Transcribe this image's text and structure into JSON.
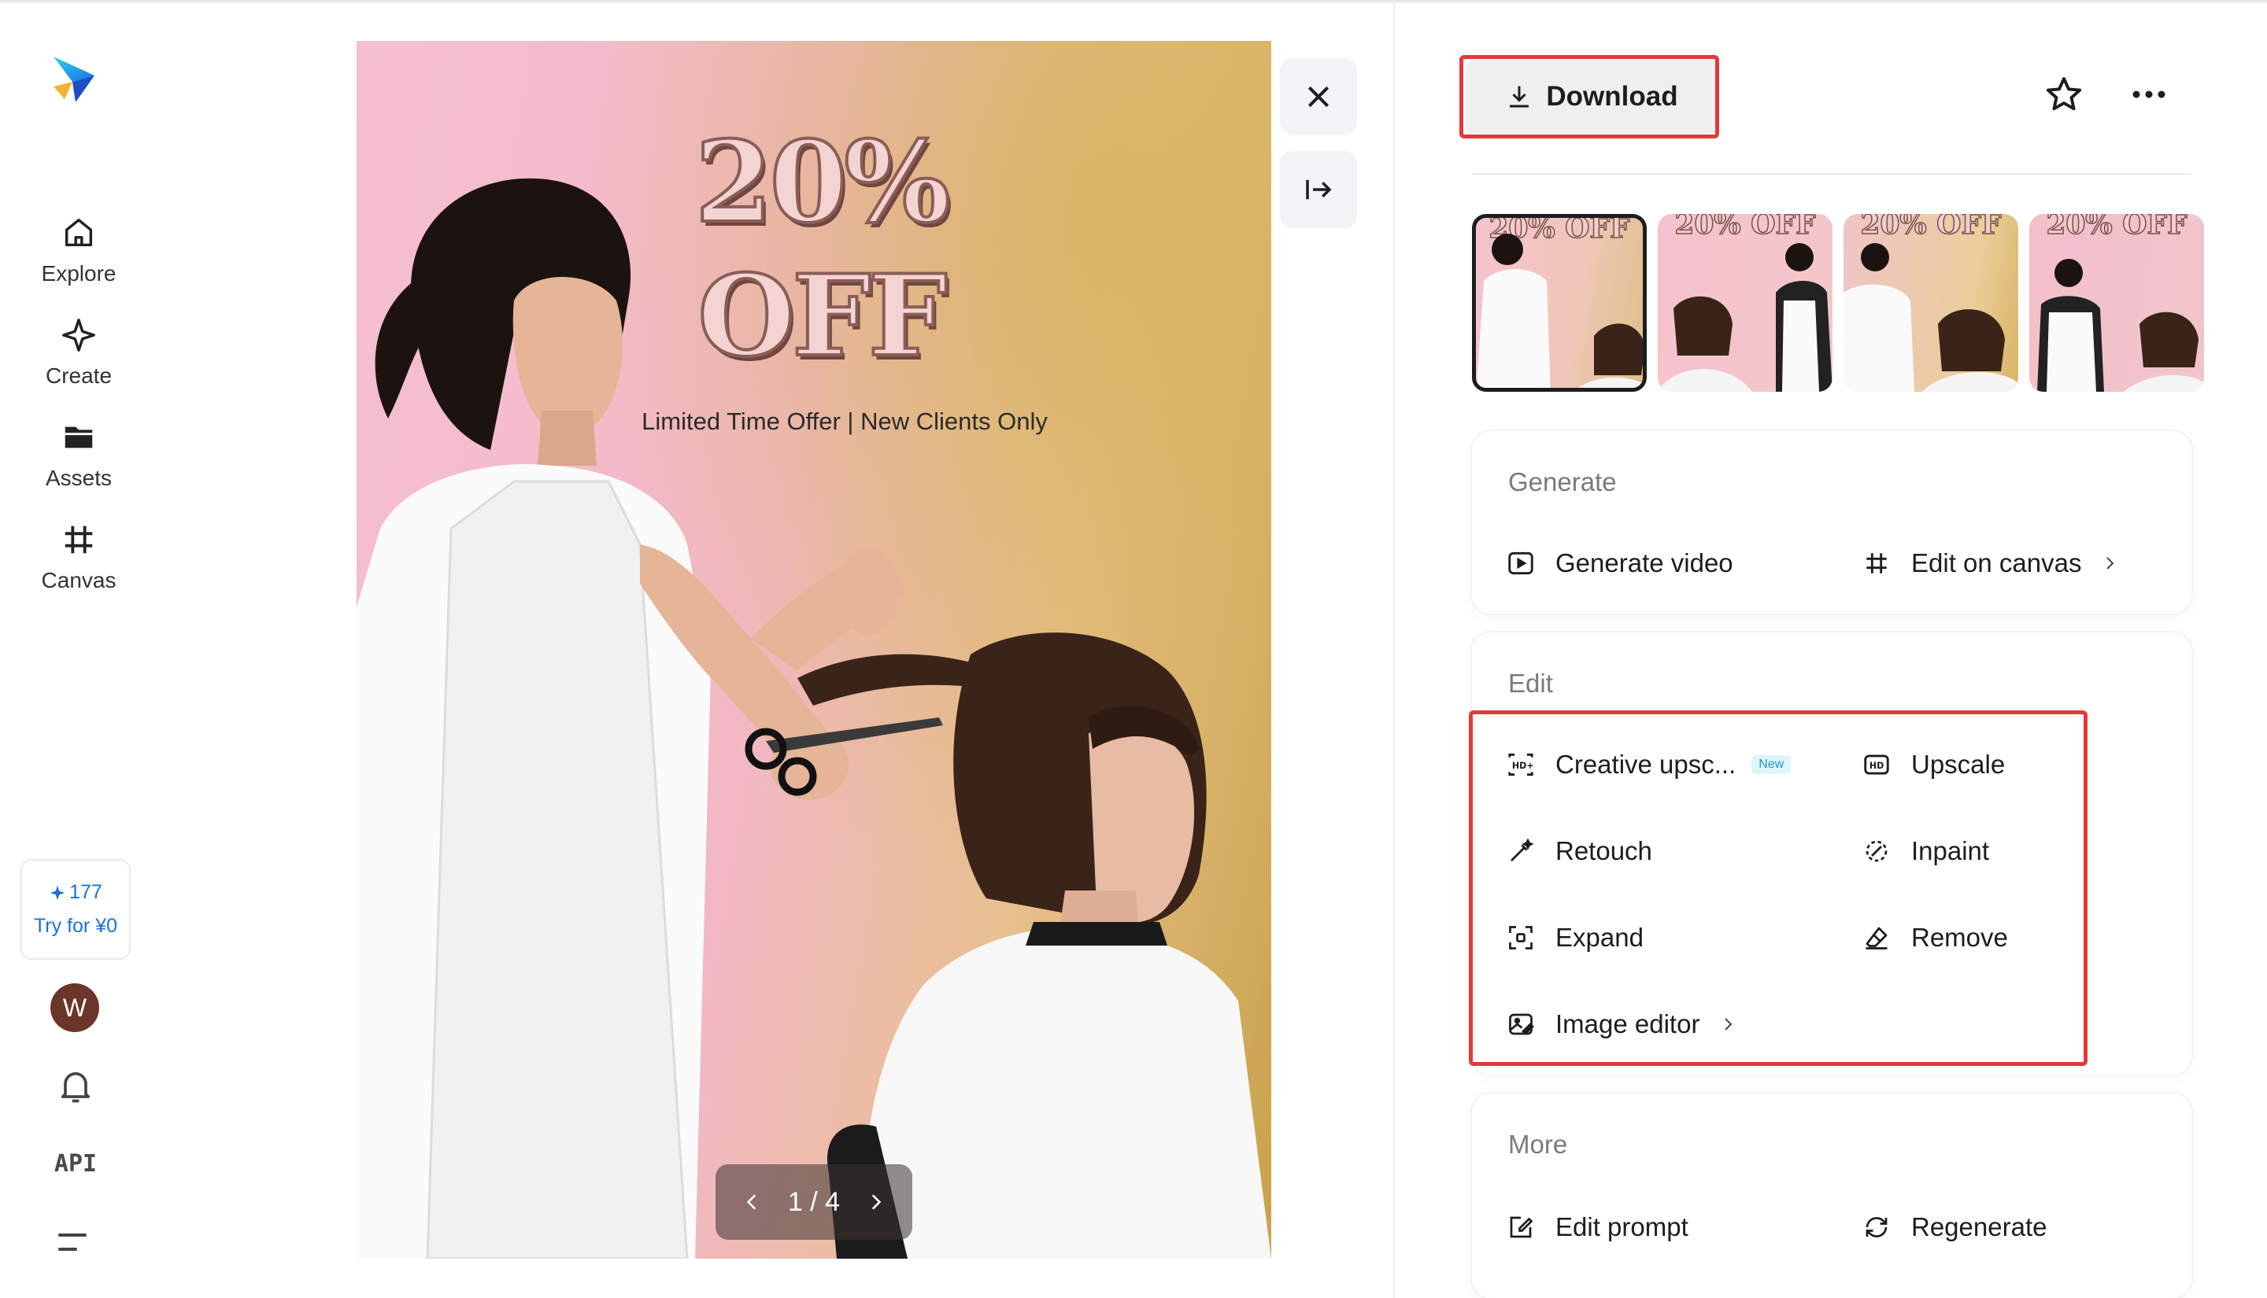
{
  "nav": {
    "items": [
      {
        "label": "Explore",
        "icon": "home-icon"
      },
      {
        "label": "Create",
        "icon": "sparkle-icon"
      },
      {
        "label": "Assets",
        "icon": "folder-icon"
      },
      {
        "label": "Canvas",
        "icon": "crop-grid-icon"
      }
    ],
    "credits": "177",
    "try_label": "Try for ¥0",
    "avatar_initial": "W",
    "api_label": "API"
  },
  "viewer": {
    "headline": "20% OFF",
    "subline": "Limited Time Offer | New Clients Only",
    "page_indicator": "1 / 4",
    "current_page": 1,
    "total_pages": 4
  },
  "panel": {
    "download_label": "Download",
    "thumb_caption": "20% OFF",
    "generate": {
      "title": "Generate",
      "generate_video": "Generate video",
      "edit_on_canvas": "Edit on canvas"
    },
    "edit": {
      "title": "Edit",
      "creative_upscale": "Creative upsc...",
      "new_badge": "New",
      "upscale": "Upscale",
      "retouch": "Retouch",
      "inpaint": "Inpaint",
      "expand": "Expand",
      "remove": "Remove",
      "image_editor": "Image editor"
    },
    "more": {
      "title": "More",
      "edit_prompt": "Edit prompt",
      "regenerate": "Regenerate"
    }
  },
  "colors": {
    "accent_blue": "#1a73d9",
    "highlight_red": "#e23a3a",
    "avatar_bg": "#6b3529"
  }
}
